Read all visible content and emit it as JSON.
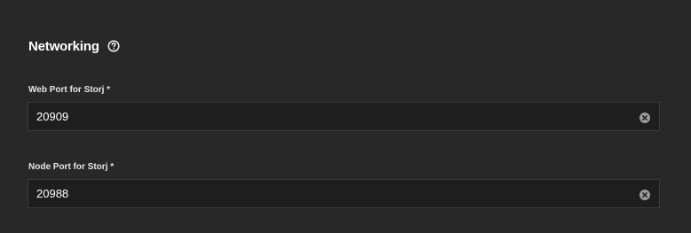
{
  "section": {
    "title": "Networking",
    "help_icon": "help-circle-icon"
  },
  "fields": {
    "web_port": {
      "label": "Web Port for Storj *",
      "value": "20909",
      "clear_icon": "clear-icon"
    },
    "node_port": {
      "label": "Node Port for Storj *",
      "value": "20988",
      "clear_icon": "clear-icon"
    }
  },
  "colors": {
    "background": "#282828",
    "input_background": "#1e1e1e",
    "input_border": "#3a3a3a",
    "text": "#ffffff",
    "icon": "#9a9a9a"
  }
}
